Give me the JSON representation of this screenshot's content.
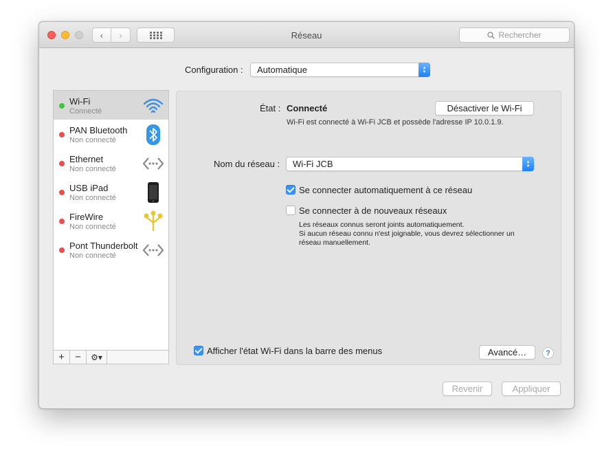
{
  "window": {
    "title": "Réseau"
  },
  "toolbar": {
    "search_placeholder": "Rechercher"
  },
  "config": {
    "label": "Configuration :",
    "value": "Automatique"
  },
  "services": [
    {
      "name": "Wi-Fi",
      "status": "Connecté",
      "state": "connected",
      "icon": "wifi-icon",
      "selected": true
    },
    {
      "name": "PAN Bluetooth",
      "status": "Non connecté",
      "state": "disconnected",
      "icon": "bluetooth-icon"
    },
    {
      "name": "Ethernet",
      "status": "Non connecté",
      "state": "disconnected",
      "icon": "ethernet-icon"
    },
    {
      "name": "USB iPad",
      "status": "Non connecté",
      "state": "disconnected",
      "icon": "ipad-icon"
    },
    {
      "name": "FireWire",
      "status": "Non connecté",
      "state": "disconnected",
      "icon": "firewire-icon"
    },
    {
      "name": "Pont Thunderbolt",
      "status": "Non connecté",
      "state": "disconnected",
      "icon": "thunderbolt-bridge-icon"
    }
  ],
  "sidebar_footer": {
    "add": "+",
    "remove": "−",
    "gear": "⚙▾"
  },
  "detail": {
    "status_label": "État :",
    "status_value": "Connecté",
    "status_desc": "Wi-Fi est connecté à Wi-Fi JCB et possède l'adresse IP 10.0.1.9.",
    "disable_button": "Désactiver le Wi-Fi",
    "network_label": "Nom du réseau :",
    "network_value": "Wi-Fi JCB",
    "auto_join_label": "Se connecter automatiquement à ce réseau",
    "auto_join_checked": true,
    "ask_new_label": "Se connecter à de nouveaux réseaux",
    "ask_new_checked": false,
    "note_line1": "Les réseaux connus seront joints automatiquement.",
    "note_line2": "Si aucun réseau connu n'est joignable, vous devrez sélectionner un",
    "note_line3": "réseau manuellement.",
    "show_menu_label": "Afficher l'état Wi-Fi dans la barre des menus",
    "show_menu_checked": true,
    "advanced_button": "Avancé…",
    "help_button": "?"
  },
  "footer": {
    "revert": "Revenir",
    "apply": "Appliquer"
  },
  "colors": {
    "accent": "#3b93f7",
    "connected": "#3fc43f",
    "disconnected": "#e85050"
  }
}
